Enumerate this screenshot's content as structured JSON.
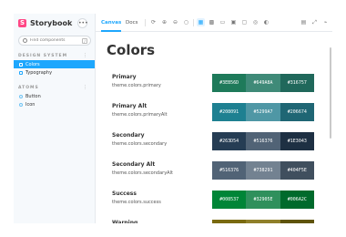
{
  "app": {
    "brand": "Storybook",
    "menu_icon": "ellipsis-icon"
  },
  "sidebar": {
    "search_placeholder": "Find components",
    "search_shortcut": "/",
    "groups": [
      {
        "title": "DESIGN SYSTEM",
        "toggle": "⋮"
      },
      {
        "title": "ATOMS",
        "toggle": "⋮"
      }
    ],
    "design_items": [
      {
        "label": "Colors"
      },
      {
        "label": "Typography"
      }
    ],
    "atom_items": [
      {
        "label": "Button"
      },
      {
        "label": "Icon"
      }
    ]
  },
  "toolbar": {
    "tabs": [
      {
        "label": "Canvas"
      },
      {
        "label": "Docs"
      }
    ]
  },
  "main": {
    "title": "Colors",
    "colors": [
      {
        "name": "Primary",
        "token": "theme.colors.primary",
        "swatches": [
          "#3EB56D",
          "#649A8A",
          "#316757"
        ],
        "bg": [
          "#1e7a5a",
          "#3f8a78",
          "#20685b"
        ]
      },
      {
        "name": "Primary Alt",
        "token": "theme.colors.primaryAlt",
        "swatches": [
          "#208091",
          "#5299A7",
          "#206674"
        ],
        "bg": [
          "#1e8091",
          "#4f97a5",
          "#1f6674"
        ]
      },
      {
        "name": "Secondary",
        "token": "theme.colors.secondary",
        "swatches": [
          "#263D54",
          "#516376",
          "#1E3043"
        ],
        "bg": [
          "#263d54",
          "#516376",
          "#1e3043"
        ]
      },
      {
        "name": "Secondary Alt",
        "token": "theme.colors.secondaryAlt",
        "swatches": [
          "#516376",
          "#738291",
          "#404F5E"
        ],
        "bg": [
          "#516376",
          "#738291",
          "#404f5e"
        ]
      },
      {
        "name": "Success",
        "token": "theme.colors.success",
        "swatches": [
          "#008537",
          "#32905E",
          "#006A2C"
        ],
        "bg": [
          "#008537",
          "#2f905c",
          "#006a2c"
        ]
      },
      {
        "name": "Warning",
        "token": "",
        "swatches": [
          "",
          "",
          ""
        ],
        "bg": [
          "#7a6a10",
          "#8f7f2a",
          "#5f530a"
        ]
      }
    ]
  }
}
